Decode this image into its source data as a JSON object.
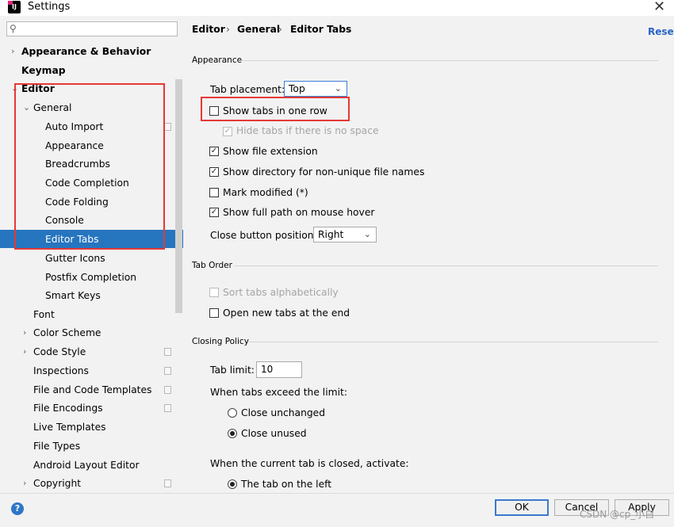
{
  "window": {
    "title": "Settings",
    "app_icon_text": "IJ"
  },
  "search": {
    "placeholder": ""
  },
  "sidebar": {
    "items": [
      {
        "label": "Appearance & Behavior",
        "arrow": "›"
      },
      {
        "label": "Keymap"
      },
      {
        "label": "Editor",
        "arrow": "⌄"
      },
      {
        "label": "General",
        "arrow": "⌄"
      },
      {
        "label": "Auto Import"
      },
      {
        "label": "Appearance"
      },
      {
        "label": "Breadcrumbs"
      },
      {
        "label": "Code Completion"
      },
      {
        "label": "Code Folding"
      },
      {
        "label": "Console"
      },
      {
        "label": "Editor Tabs",
        "selected": true
      },
      {
        "label": "Gutter Icons"
      },
      {
        "label": "Postfix Completion"
      },
      {
        "label": "Smart Keys"
      },
      {
        "label": "Font"
      },
      {
        "label": "Color Scheme",
        "arrow": "›"
      },
      {
        "label": "Code Style",
        "arrow": "›"
      },
      {
        "label": "Inspections"
      },
      {
        "label": "File and Code Templates"
      },
      {
        "label": "File Encodings"
      },
      {
        "label": "Live Templates"
      },
      {
        "label": "File Types"
      },
      {
        "label": "Android Layout Editor"
      },
      {
        "label": "Copyright",
        "arrow": "›"
      }
    ]
  },
  "breadcrumb": {
    "items": [
      "Editor",
      "General",
      "Editor Tabs"
    ],
    "separator": "›"
  },
  "reset_label": "Reset",
  "sections": {
    "appearance": "Appearance",
    "tab_order": "Tab Order",
    "closing_policy": "Closing Policy"
  },
  "appearance": {
    "tab_placement_label": "Tab placement:",
    "tab_placement_value": "Top",
    "show_tabs_one_row": "Show tabs in one row",
    "hide_tabs_no_space": "Hide tabs if there is no space",
    "show_file_extension": "Show file extension",
    "show_directory": "Show directory for non-unique file names",
    "mark_modified": "Mark modified (*)",
    "show_full_path": "Show full path on mouse hover",
    "close_button_label": "Close button position:",
    "close_button_value": "Right"
  },
  "tab_order": {
    "sort_alpha": "Sort tabs alphabetically",
    "open_at_end": "Open new tabs at the end"
  },
  "closing_policy": {
    "tab_limit_label": "Tab limit:",
    "tab_limit_value": "10",
    "exceed_label": "When tabs exceed the limit:",
    "close_unchanged": "Close unchanged",
    "close_unused": "Close unused",
    "activate_label": "When the current tab is closed, activate:",
    "tab_on_left": "The tab on the left"
  },
  "checkmark": "✓",
  "buttons": {
    "ok": "OK",
    "cancel": "Cancel",
    "apply": "Apply",
    "help": "?"
  },
  "watermark": "CSDN @cp_小白",
  "colors": {
    "selection": "#2675bf",
    "accent": "#2a64c7",
    "highlight_box": "#e53935"
  }
}
